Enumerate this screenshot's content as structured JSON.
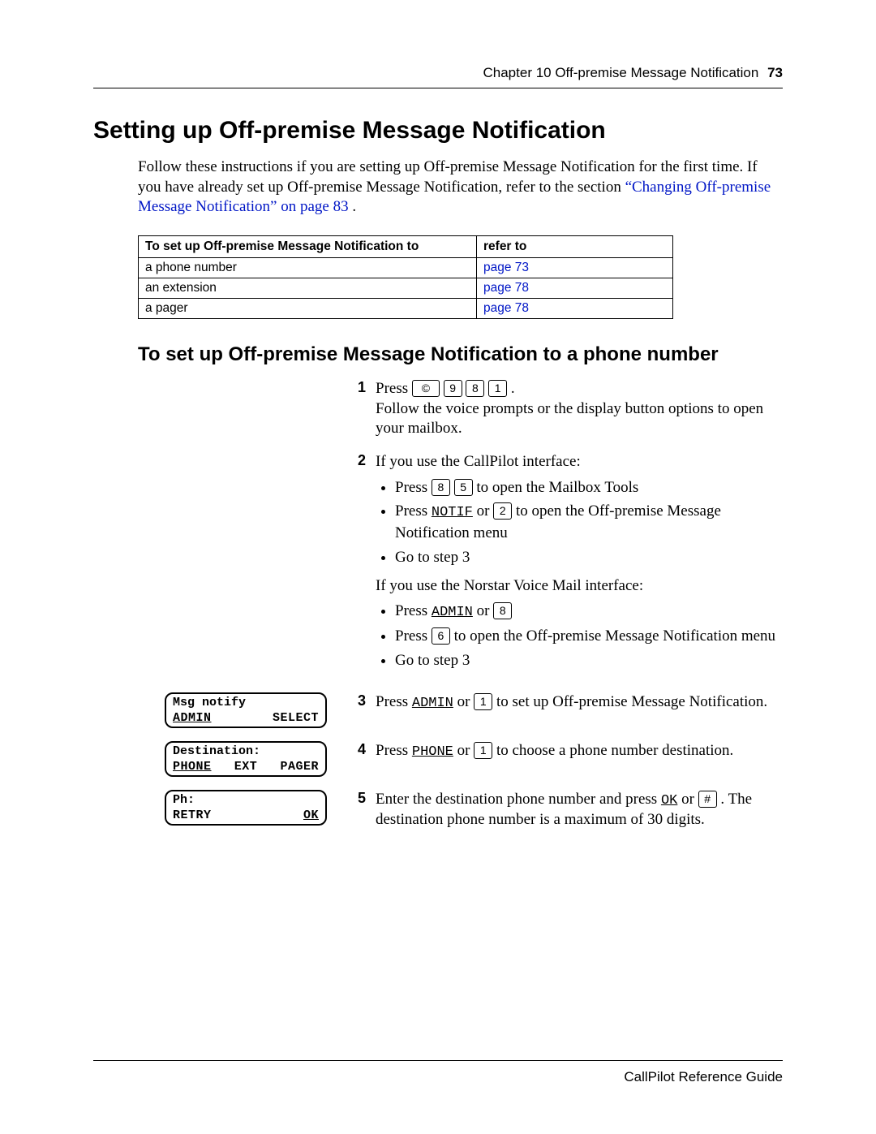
{
  "header": {
    "chapter": "Chapter 10  Off-premise Message Notification",
    "page": "73"
  },
  "h1": "Setting up Off-premise Message Notification",
  "intro": {
    "text1": "Follow these instructions if you are setting up Off-premise Message Notification for the first time. If you have already set up Off-premise Message Notification, refer to the section ",
    "link": "“Changing Off-premise Message Notification” on page 83",
    "text2": "."
  },
  "table": {
    "header_left": "To set up Off-premise Message Notification to",
    "header_right": "refer to",
    "rows": [
      {
        "left": "a phone number",
        "right": "page 73"
      },
      {
        "left": "an extension",
        "right": "page 78"
      },
      {
        "left": "a pager",
        "right": "page 78"
      }
    ]
  },
  "h2": "To set up Off-premise Message Notification to a phone number",
  "steps": {
    "s1": {
      "num": "1",
      "pre": "Press ",
      "keys": [
        "©",
        "9",
        "8",
        "1"
      ],
      "post": " .",
      "line2": "Follow the voice prompts or the display button options to open your mailbox."
    },
    "s2": {
      "num": "2",
      "lead": "If you use the CallPilot interface:",
      "bullets_a": [
        {
          "pre": "Press ",
          "keys": [
            "8",
            "5"
          ],
          "post": "  to open the Mailbox Tools"
        },
        {
          "pre": "Press ",
          "soft": "NOTIF",
          "mid": " or ",
          "keys": [
            "2"
          ],
          "post": "  to open the Off-premise Message Notification menu"
        },
        {
          "text": "Go to step 3"
        }
      ],
      "mid": "If you use the Norstar Voice Mail interface:",
      "bullets_b": [
        {
          "pre": "Press ",
          "soft": "ADMIN",
          "mid": " or ",
          "keys": [
            "8"
          ],
          "post": ""
        },
        {
          "pre": "Press  ",
          "keys": [
            "6"
          ],
          "post": "  to open the Off-premise Message Notification menu"
        },
        {
          "text": "Go to step 3"
        }
      ]
    },
    "s3": {
      "num": "3",
      "display": {
        "line1": "Msg notify",
        "left": "ADMIN",
        "right": "SELECT",
        "ul_left": true
      },
      "pre": "Press ",
      "soft": "ADMIN",
      "mid": " or ",
      "keys": [
        "1"
      ],
      "post": "  to set up Off-premise Message Notification."
    },
    "s4": {
      "num": "4",
      "display": {
        "line1": "Destination:",
        "triple": [
          "PHONE",
          "EXT",
          "PAGER"
        ],
        "ul_index": 0
      },
      "pre": "Press ",
      "soft": "PHONE",
      "mid": " or ",
      "keys": [
        "1"
      ],
      "post": "  to choose a phone number destination."
    },
    "s5": {
      "num": "5",
      "display": {
        "line1": "Ph:",
        "left": "RETRY",
        "right": "OK",
        "ul_right": true
      },
      "pre": "Enter the destination phone number and press ",
      "soft": "OK",
      "mid": " or ",
      "keys": [
        "#"
      ],
      "post": " . The destination phone number is a maximum of 30 digits."
    }
  },
  "footer": "CallPilot Reference Guide"
}
